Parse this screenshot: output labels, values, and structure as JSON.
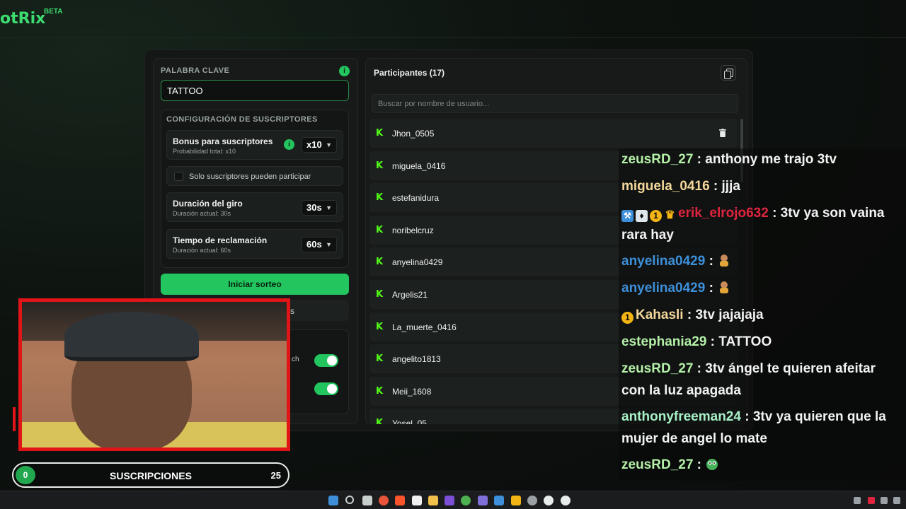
{
  "app": {
    "logo": "otRix",
    "beta": "BETA"
  },
  "keyword": {
    "label": "PALABRA CLAVE",
    "value": "TATTOO",
    "info_icon": "i"
  },
  "subscribers": {
    "section_label": "CONFIGURACIÓN DE SUSCRIPTORES",
    "bonus": {
      "title": "Bonus para suscriptores",
      "subtitle": "Probabilidad total: x10",
      "value": "x10"
    },
    "only_subs": "Solo suscriptores pueden participar",
    "spin_duration": {
      "title": "Duración del giro",
      "subtitle": "Duración actual: 30s",
      "value": "30s"
    },
    "claim_time": {
      "title": "Tiempo de reclamación",
      "subtitle": "Duración actual: 60s",
      "value": "60s"
    }
  },
  "start_button": "Iniciar sorteo",
  "second_button_tail": "s",
  "toggle_hint": "ch",
  "participants": {
    "title": "Participantes (17)",
    "search_placeholder": "Buscar por nombre de usuario...",
    "list": [
      "Jhon_0505",
      "miguela_0416",
      "estefanidura",
      "noribelcruz",
      "anyelina0429",
      "Argelis21",
      "La_muerte_0416",
      "angelito1813",
      "Meii_1608",
      "Yosel_05"
    ]
  },
  "subs_bar": {
    "current": "0",
    "label": "SUSCRIPCIONES",
    "goal": "25",
    "progress": 0
  },
  "chat": [
    {
      "user": "zeusRD_27",
      "color": "#b4f0a8",
      "sep": " : ",
      "text": "anthony me trajo 3tv"
    },
    {
      "user": "miguela_0416",
      "color": "#f3d79a",
      "sep": " : ",
      "text": "jjja"
    },
    {
      "user": "erik_elrojo632",
      "color": "#e0243f",
      "sep": " : ",
      "text": "3tv ya son vaina rara hay"
    },
    {
      "user": "anyelina0429",
      "color": "#3d8fd9",
      "sep": " :",
      "text": ""
    },
    {
      "user": "anyelina0429",
      "color": "#3d8fd9",
      "sep": " :",
      "text": ""
    },
    {
      "user": "Kahasli",
      "color": "#f3d79a",
      "sep": " : ",
      "text": "3tv jajajaja"
    },
    {
      "user": "estephania29",
      "color": "#b4f0a8",
      "sep": " : ",
      "text": "TATTOO"
    },
    {
      "user": "zeusRD_27",
      "color": "#b4f0a8",
      "sep": " : ",
      "text": "3tv ángel te quieren afeitar con la luz apagada"
    },
    {
      "user": "anthonyfreeman24",
      "color": "#a8f0c8",
      "sep": " : ",
      "text": "3tv ya quieren que la mujer de angel lo mate"
    },
    {
      "user": "zeusRD_27",
      "color": "#b4f0a8",
      "sep": " :",
      "text": ""
    }
  ],
  "colors": {
    "accent": "#22c55e",
    "kick_green": "#53fc18",
    "webcam_border": "#e11418"
  },
  "icons": {
    "kick": "kick-icon",
    "trash": "trash-icon",
    "copy": "copy-icon",
    "chevron": "chevron-down-icon"
  }
}
